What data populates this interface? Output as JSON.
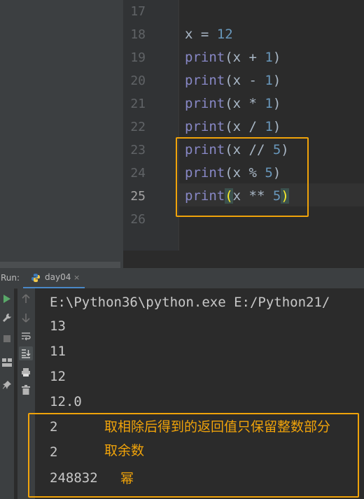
{
  "editor": {
    "lines": [
      {
        "no": "17",
        "current": false,
        "tokens": []
      },
      {
        "no": "18",
        "current": false,
        "tokens": [
          {
            "t": "x = ",
            "c": ""
          },
          {
            "t": "12",
            "c": "num"
          }
        ]
      },
      {
        "no": "19",
        "current": false,
        "tokens": [
          {
            "t": "print",
            "c": "kw"
          },
          {
            "t": "(x + ",
            "c": ""
          },
          {
            "t": "1",
            "c": "num"
          },
          {
            "t": ")",
            "c": ""
          }
        ]
      },
      {
        "no": "20",
        "current": false,
        "tokens": [
          {
            "t": "print",
            "c": "kw"
          },
          {
            "t": "(x - ",
            "c": ""
          },
          {
            "t": "1",
            "c": "num"
          },
          {
            "t": ")",
            "c": ""
          }
        ]
      },
      {
        "no": "21",
        "current": false,
        "tokens": [
          {
            "t": "print",
            "c": "kw"
          },
          {
            "t": "(x * ",
            "c": ""
          },
          {
            "t": "1",
            "c": "num"
          },
          {
            "t": ")",
            "c": ""
          }
        ]
      },
      {
        "no": "22",
        "current": false,
        "tokens": [
          {
            "t": "print",
            "c": "kw"
          },
          {
            "t": "(x / ",
            "c": ""
          },
          {
            "t": "1",
            "c": "num"
          },
          {
            "t": ")",
            "c": ""
          }
        ]
      },
      {
        "no": "23",
        "current": false,
        "tokens": [
          {
            "t": "print",
            "c": "kw"
          },
          {
            "t": "(x // ",
            "c": ""
          },
          {
            "t": "5",
            "c": "num"
          },
          {
            "t": ")",
            "c": ""
          }
        ]
      },
      {
        "no": "24",
        "current": false,
        "tokens": [
          {
            "t": "print",
            "c": "kw"
          },
          {
            "t": "(x % ",
            "c": ""
          },
          {
            "t": "5",
            "c": "num"
          },
          {
            "t": ")",
            "c": ""
          }
        ]
      },
      {
        "no": "25",
        "current": true,
        "tokens": [
          {
            "t": "print",
            "c": "kw"
          },
          {
            "t": "(",
            "c": "paren-hl"
          },
          {
            "t": "x ** ",
            "c": ""
          },
          {
            "t": "5",
            "c": "num"
          },
          {
            "t": ")",
            "c": "paren-hl"
          }
        ]
      },
      {
        "no": "26",
        "current": false,
        "tokens": []
      }
    ]
  },
  "run_panel": {
    "label": "Run:",
    "tab_label": "day04",
    "tab_close": "×"
  },
  "console": {
    "command": "E:\\Python36\\python.exe E:/Python21/",
    "outputs": [
      "13",
      "11",
      "12",
      "12.0",
      "2",
      "2",
      "248832"
    ],
    "notes": {
      "floor_div": "取相除后得到的返回值只保留整数部分",
      "modulo": "取余数",
      "power": "幂"
    }
  },
  "colors": {
    "highlight": "#f0a30a",
    "keyword": "#8888c6",
    "number": "#6897bb",
    "run_icon": "#59a869"
  },
  "icons": [
    "run-icon",
    "wrench-icon",
    "stop-icon",
    "layout-icon",
    "pin-icon",
    "up-arrow-icon",
    "down-arrow-icon",
    "soft-wrap-icon",
    "scroll-to-end-icon",
    "print-icon",
    "trash-icon",
    "python-file-icon",
    "close-icon"
  ]
}
